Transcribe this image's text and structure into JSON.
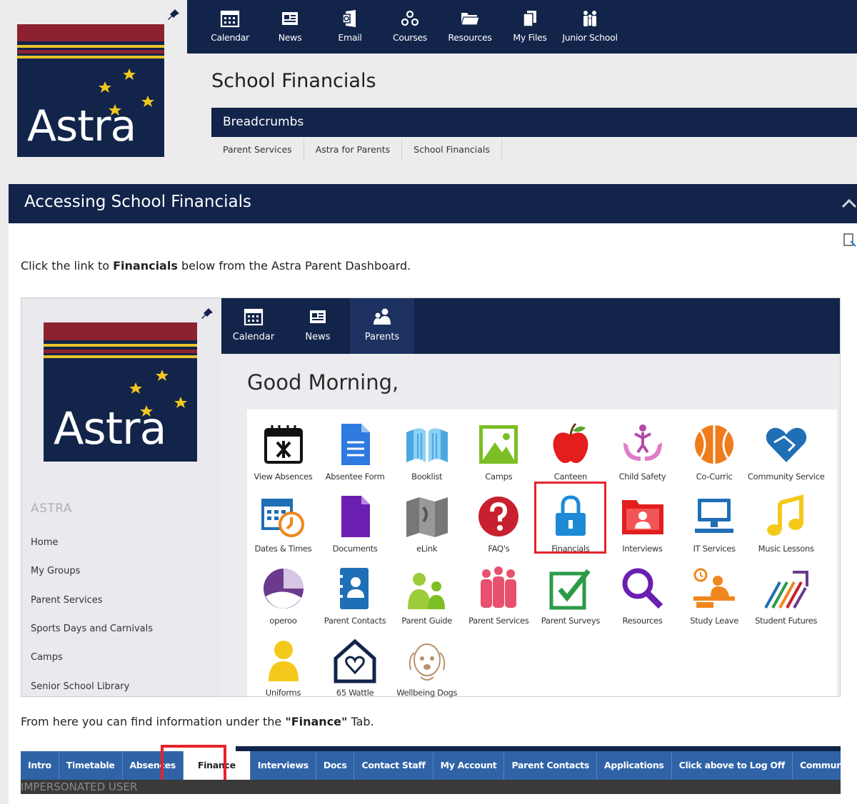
{
  "logo": {
    "word": "Astra",
    "colors": {
      "navy": "#12244a",
      "red": "#8c2230",
      "gold": "#e8c22a"
    }
  },
  "topnav": [
    {
      "label": "Calendar",
      "icon": "calendar-icon"
    },
    {
      "label": "News",
      "icon": "news-icon"
    },
    {
      "label": "Email",
      "icon": "email-icon"
    },
    {
      "label": "Courses",
      "icon": "courses-icon"
    },
    {
      "label": "Resources",
      "icon": "folder-icon"
    },
    {
      "label": "My Files",
      "icon": "files-icon"
    },
    {
      "label": "Junior School",
      "icon": "people-icon"
    }
  ],
  "page": {
    "title": "School Financials"
  },
  "breadcrumb": {
    "heading": "Breadcrumbs",
    "items": [
      "Parent Services",
      "Astra for Parents",
      "School Financials"
    ]
  },
  "section": {
    "title": "Accessing School Financials",
    "intro_pre": "Click the link to ",
    "intro_bold": "Financials",
    "intro_post": " below from the Astra Parent Dashboard.",
    "outro_pre": "From here you can find information under the ",
    "outro_bold": "\"Finance\"",
    "outro_post": " Tab."
  },
  "dashboard": {
    "nav": [
      {
        "label": "Calendar",
        "icon": "calendar-icon"
      },
      {
        "label": "News",
        "icon": "news-icon"
      },
      {
        "label": "Parents",
        "icon": "parents-icon",
        "active": true
      }
    ],
    "greeting": "Good Morning,",
    "side_heading": "ASTRA",
    "side_links": [
      "Home",
      "My Groups",
      "Parent Services",
      "Sports Days and Carnivals",
      "Camps",
      "Senior School Library"
    ],
    "tiles": [
      "View Absences",
      "Absentee Form",
      "Booklist",
      "Camps",
      "Canteen",
      "Child Safety",
      "Co-Curric",
      "Community Service",
      "Dates & Times",
      "Documents",
      "eLink",
      "FAQ's",
      "Financials",
      "Interviews",
      "IT Services",
      "Music Lessons",
      "operoo",
      "Parent Contacts",
      "Parent Guide",
      "Parent Services",
      "Parent Surveys",
      "Resources",
      "Study Leave",
      "Student Futures",
      "Uniforms",
      "65 Wattle",
      "Wellbeing Dogs"
    ],
    "highlight_color": "#e5232b"
  },
  "tabs": {
    "items": [
      "Intro",
      "Timetable",
      "Absences",
      "Finance",
      "Interviews",
      "Docs",
      "Contact Staff",
      "My Account",
      "Parent Contacts",
      "Applications",
      "Click above to Log Off",
      "Communications"
    ],
    "selected": "Finance",
    "impersonated": "IMPERSONATED USER"
  }
}
